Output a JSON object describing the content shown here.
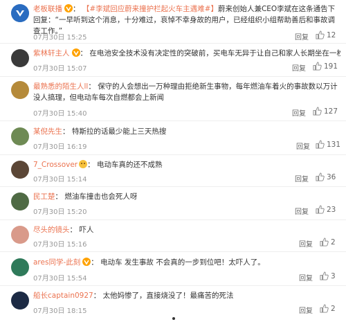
{
  "comments": [
    {
      "user": "老板联播",
      "verified": true,
      "text_tag": "【#李斌回应蔚来撞护栏起火车主遇难#】",
      "text": "蔚来创始人兼CEO李斌在这条通告下回复：“一早听到这个消息，十分难过，哀悼不幸身故的用户，已经组织小组帮助善后和事故调查工作。”",
      "time": "07月30日 15:25",
      "reply": "回复",
      "likes": "12",
      "avatar_color": "#2a6cc0"
    },
    {
      "user": "紫林轩主人",
      "verified": true,
      "text": "在电池安全技术没有决定性的突破前，买电车无异于让自己和家人长期坐在一枚燃烧弹上",
      "time": "07月30日 15:07",
      "reply": "回复",
      "likes": "191",
      "avatar_color": "#3a3a3a"
    },
    {
      "user": "最熟悉的陌生人ll",
      "text": "保守的人会想出一万种理由拒绝新生事物，每年燃油车着火的事故数以万计没人搞理，但电动车每次自燃都会上新闻",
      "time": "07月30日 15:40",
      "reply": "回复",
      "likes": "127",
      "avatar_color": "#b58a3a"
    },
    {
      "user": "某倪先生",
      "text": "特斯拉的话最少能上三天热搜",
      "time": "07月30日 16:19",
      "reply": "回复",
      "likes": "131",
      "avatar_color": "#6e8a54"
    },
    {
      "user": "7_Crossover",
      "emoji": true,
      "text": "电动车真的还不成熟",
      "time": "07月30日 15:14",
      "reply": "回复",
      "likes": "36",
      "avatar_color": "#5b4636"
    },
    {
      "user": "民工楚",
      "text": "燃油车撞击也会死人呀",
      "time": "07月30日 15:20",
      "reply": "回复",
      "likes": "23",
      "avatar_color": "#4f6a44"
    },
    {
      "user": "尽头的镜头",
      "text": "吓人",
      "time": "07月30日 15:16",
      "reply": "回复",
      "likes": "2",
      "avatar_color": "#d99a8a"
    },
    {
      "user": "ares同学-此刻",
      "verified": true,
      "text": "电动车 发生事故 不会真的一步到位吧！太吓人了。",
      "time": "07月30日 15:54",
      "reply": "回复",
      "likes": "3",
      "avatar_color": "#2f7a5a"
    },
    {
      "user": "船长captain0927",
      "text": "太他妈惨了，直接烧没了！最痛苦的死法",
      "time": "07月30日 18:15",
      "reply": "回复",
      "likes": "2",
      "avatar_color": "#1c2a44"
    }
  ],
  "colors": {
    "link": "#eb7350",
    "verified": "#ffa200",
    "muted": "#999999"
  }
}
